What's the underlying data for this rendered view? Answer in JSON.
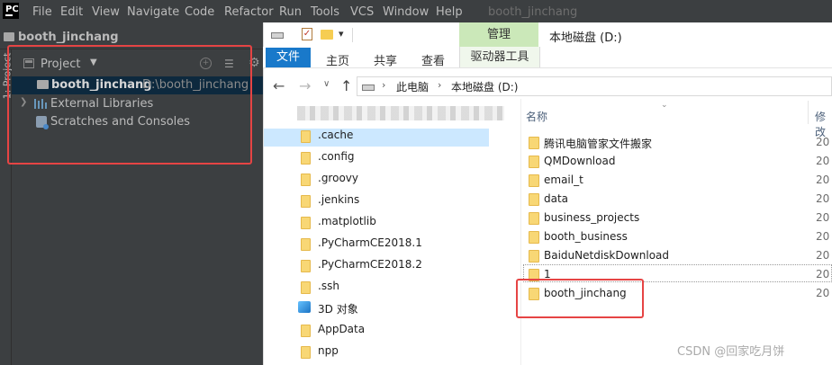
{
  "ide": {
    "logo": "PC",
    "menu": [
      "File",
      "Edit",
      "View",
      "Navigate",
      "Code",
      "Refactor",
      "Run",
      "Tools",
      "VCS",
      "Window",
      "Help"
    ],
    "window_title": "booth_jinchang",
    "breadcrumb": "booth_jinchang",
    "side_tool_label": "1: Project",
    "project_panel": {
      "title": "Project",
      "tree": {
        "root_label": "booth_jinchang",
        "root_path": "D:\\booth_jinchang",
        "external_libraries": "External Libraries",
        "scratches": "Scratches and Consoles"
      }
    },
    "highlight_color": "#e64444"
  },
  "explorer": {
    "ribbon": {
      "manage": "管理",
      "title": "本地磁盘 (D:)",
      "tabs": [
        "文件",
        "主页",
        "共享",
        "查看"
      ],
      "drive_tools": "驱动器工具"
    },
    "address": {
      "this_pc": "此电脑",
      "drive": "本地磁盘 (D:)"
    },
    "nav_items": [
      ".cache",
      ".config",
      ".groovy",
      ".jenkins",
      ".matplotlib",
      ".PyCharmCE2018.1",
      ".PyCharmCE2018.2",
      ".ssh",
      "3D 对象",
      "AppData",
      "npp"
    ],
    "columns": {
      "name": "名称",
      "modified": "修改"
    },
    "files": [
      {
        "name": "腾讯电脑管家文件搬家",
        "date": "20"
      },
      {
        "name": "QMDownload",
        "date": "20"
      },
      {
        "name": "email_t",
        "date": "20"
      },
      {
        "name": "data",
        "date": "20"
      },
      {
        "name": "business_projects",
        "date": "20"
      },
      {
        "name": "booth_business",
        "date": "20"
      },
      {
        "name": "BaiduNetdiskDownload",
        "date": "20"
      },
      {
        "name": "1",
        "date": "20"
      },
      {
        "name": "booth_jinchang",
        "date": "20"
      }
    ],
    "accent_color": "#1979ca",
    "manage_color": "#cbe8b9"
  },
  "watermark": "CSDN @回家吃月饼"
}
